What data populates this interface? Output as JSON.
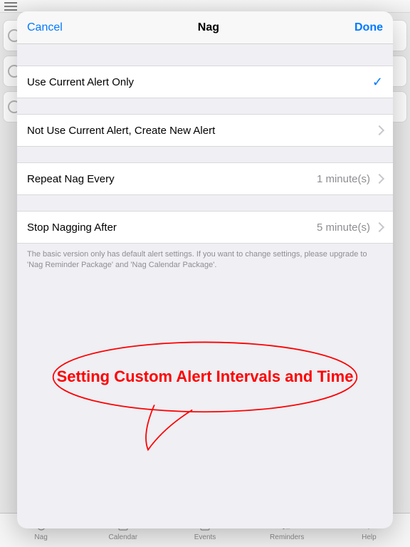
{
  "sheet": {
    "cancel": "Cancel",
    "title": "Nag",
    "done": "Done",
    "rows": {
      "useCurrent": {
        "label": "Use Current Alert Only",
        "checked": true
      },
      "notUse": {
        "label": "Not Use Current Alert, Create New Alert"
      },
      "repeat": {
        "label": "Repeat Nag Every",
        "value": "1 minute(s)"
      },
      "stop": {
        "label": "Stop Nagging After",
        "value": "5 minute(s)"
      }
    },
    "footnote": "The basic version only has default alert settings. If you want to change settings, please upgrade to 'Nag Reminder Package' and 'Nag Calendar Package'."
  },
  "annotation": {
    "text": "Setting Custom Alert Intervals and Time"
  },
  "tabs": {
    "nag": "Nag",
    "calendar": "Calendar",
    "events": "Events",
    "reminders": "Reminders",
    "help": "Help"
  }
}
